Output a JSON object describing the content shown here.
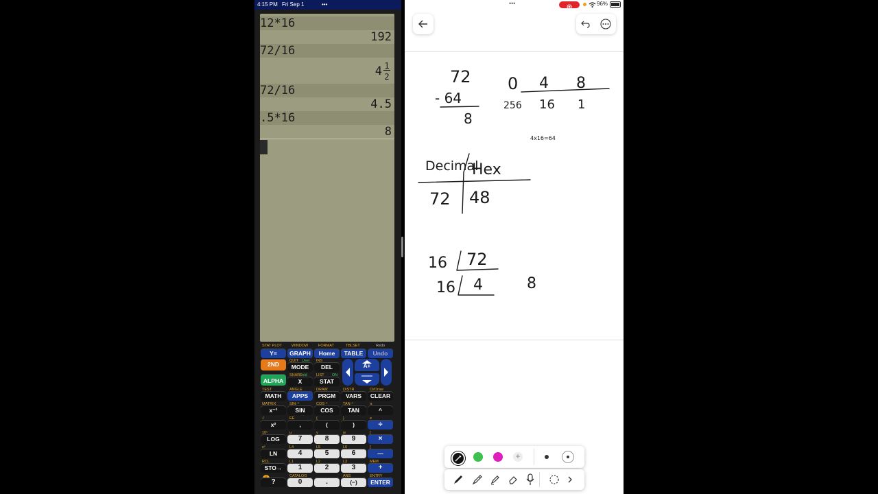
{
  "calculator": {
    "status": {
      "time": "4:15 PM",
      "date": "Fri Sep 1",
      "dots": "•••"
    },
    "history": [
      {
        "input": "12*16",
        "output": "192"
      },
      {
        "input": "72/16",
        "output_whole": "4",
        "output_num": "1",
        "output_den": "2"
      },
      {
        "input": "72/16",
        "output": "4.5"
      },
      {
        "input": ".5*16",
        "output": "8"
      }
    ],
    "keys": {
      "row0": [
        {
          "second": "STAT PLOT",
          "label": "Y="
        },
        {
          "second": "WINDOW",
          "label": "GRAPH"
        },
        {
          "second": "FORMAT",
          "label": "Home"
        },
        {
          "second": "TBLSET",
          "label": "TABLE"
        },
        {
          "second": "Redo",
          "label": "Undo"
        }
      ],
      "row1": [
        {
          "label": "2ND"
        },
        {
          "second": "QUIT",
          "second2": "User",
          "label": "MODE"
        },
        {
          "second": "INS",
          "label": "DEL"
        }
      ],
      "row2": [
        {
          "label": "ALPHA"
        },
        {
          "second": "SHARE",
          "second2": "n/d",
          "label": "X"
        },
        {
          "second": "LIST",
          "second2": "ON",
          "label": "STAT"
        }
      ],
      "arrow_mid": "A+",
      "row3": [
        {
          "second": "TEST",
          "label": "MATH"
        },
        {
          "second": "ANGLE",
          "label": "APPS"
        },
        {
          "second": "DRAW",
          "label": "PRGM"
        },
        {
          "second": "DISTR",
          "label": "VARS"
        },
        {
          "second": "ClrDraw",
          "label": "CLEAR"
        }
      ],
      "row4": [
        {
          "second": "MATRIX",
          "label": "x⁻¹"
        },
        {
          "second": "SIN⁻¹",
          "label": "SIN"
        },
        {
          "second": "COS⁻¹",
          "label": "COS"
        },
        {
          "second": "TAN⁻¹",
          "label": "TAN"
        },
        {
          "second": "π",
          "label": "^"
        }
      ],
      "row5": [
        {
          "second": "√",
          "label": "x²"
        },
        {
          "second": "EE",
          "label": ","
        },
        {
          "second": "{",
          "label": "("
        },
        {
          "second": "}",
          "label": ")"
        },
        {
          "second": "e",
          "label": "÷"
        }
      ],
      "row6": [
        {
          "second": "10ˣ",
          "label": "LOG"
        },
        {
          "second": "u",
          "label": "7"
        },
        {
          "second": "v",
          "label": "8"
        },
        {
          "second": "w",
          "label": "9"
        },
        {
          "second": "[",
          "label": "×"
        }
      ],
      "row7": [
        {
          "second": "eˣ",
          "label": "LN"
        },
        {
          "second": "L4",
          "label": "4"
        },
        {
          "second": "L5",
          "label": "5"
        },
        {
          "second": "L6",
          "label": "6"
        },
        {
          "second": "]",
          "label": "—"
        }
      ],
      "row8": [
        {
          "second": "RCL",
          "label": "STO→"
        },
        {
          "second": "L1",
          "label": "1"
        },
        {
          "second": "L2",
          "label": "2"
        },
        {
          "second": "L3",
          "label": "3"
        },
        {
          "second": "MEM",
          "label": "+"
        }
      ],
      "row9": [
        {
          "label": "?"
        },
        {
          "second": "CATALOG",
          "label": "0"
        },
        {
          "label": "."
        },
        {
          "second": "ANS",
          "label": "(−)"
        },
        {
          "second": "ENTRY",
          "label": "ENTER"
        }
      ]
    }
  },
  "notes": {
    "status": {
      "dots": "•••",
      "battery": "96%"
    },
    "handwriting": {
      "sub_top": "72",
      "sub_mid": "- 64",
      "sub_res": "8",
      "place_digits": [
        "0",
        "4",
        "8"
      ],
      "place_vals": [
        "256",
        "16",
        "1"
      ],
      "small_note": "4x16=64",
      "table_h1": "Decimal",
      "table_h2": "Hex",
      "table_v1": "72",
      "table_v2": "48",
      "div_divisor1": "16",
      "div_dividend1": "72",
      "div_divisor2": "16",
      "div_quot": "4",
      "div_rem": "8"
    },
    "colors": {
      "black": "#111111",
      "green": "#3cc14e",
      "magenta": "#e01ec0"
    }
  }
}
